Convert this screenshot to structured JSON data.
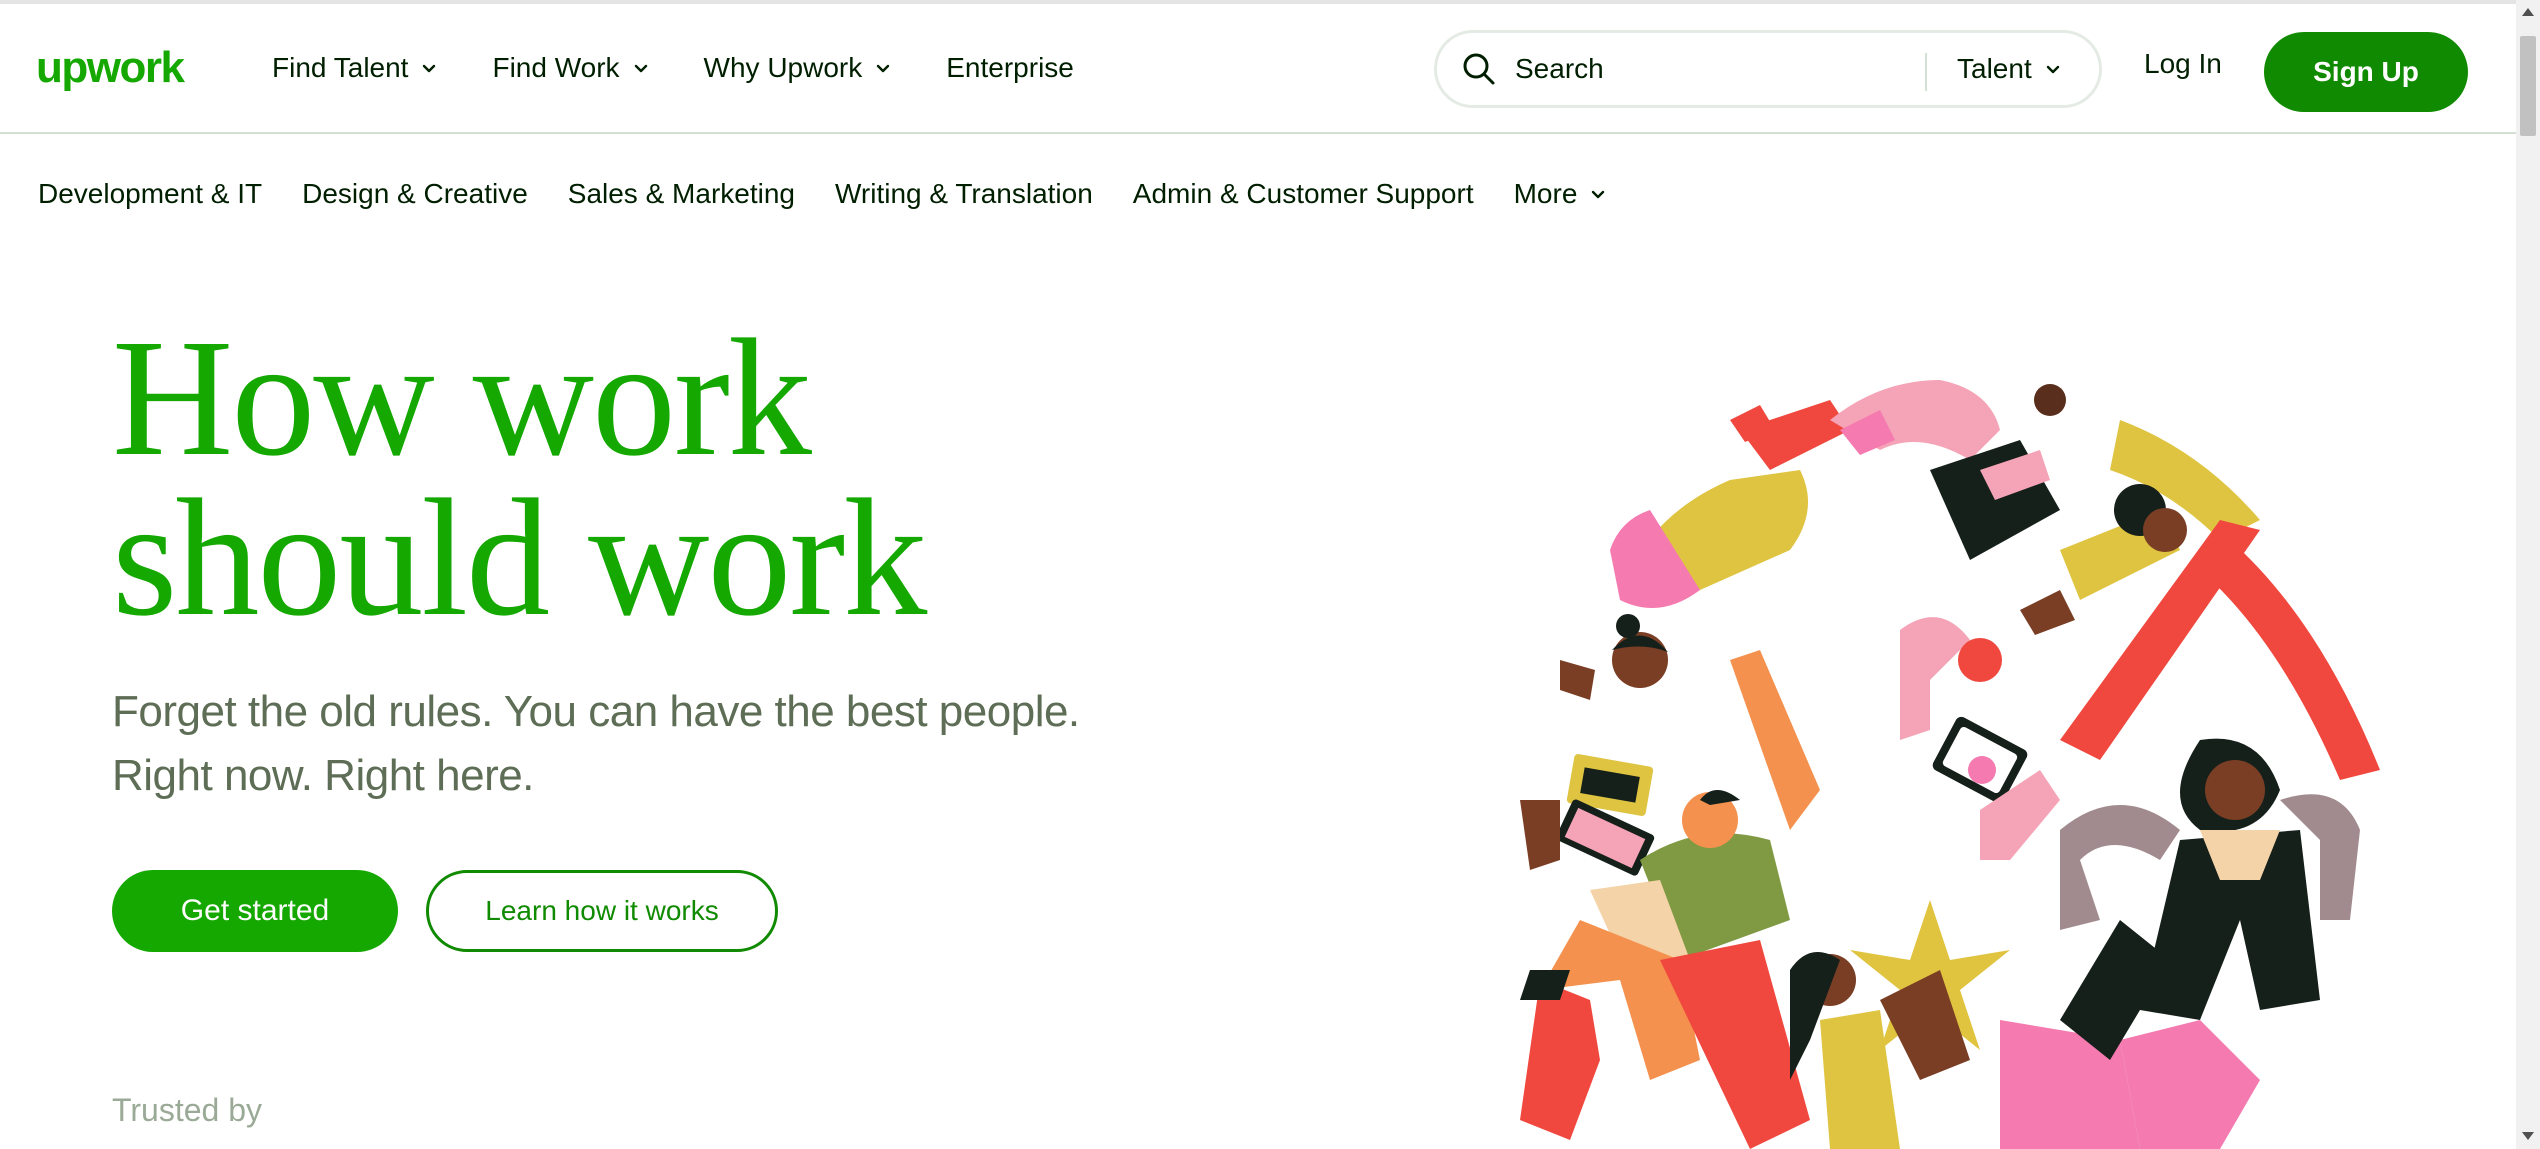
{
  "colors": {
    "brand_green": "#14a800",
    "dark_green": "#108a00",
    "text": "#001e00",
    "muted": "#5e6d55"
  },
  "header": {
    "logo_text": "upwork",
    "nav": [
      {
        "label": "Find Talent",
        "icon": "chevron-down-icon"
      },
      {
        "label": "Find Work",
        "icon": "chevron-down-icon"
      },
      {
        "label": "Why Upwork",
        "icon": "chevron-down-icon"
      },
      {
        "label": "Enterprise"
      }
    ],
    "search": {
      "placeholder": "Search",
      "scope": "Talent",
      "icon": "search-icon"
    },
    "login_label": "Log In",
    "signup_label": "Sign Up"
  },
  "categories": [
    {
      "label": "Development & IT"
    },
    {
      "label": "Design & Creative"
    },
    {
      "label": "Sales & Marketing"
    },
    {
      "label": "Writing & Translation"
    },
    {
      "label": "Admin & Customer Support"
    },
    {
      "label": "More",
      "icon": "chevron-down-icon"
    }
  ],
  "hero": {
    "headline_line1": "How work",
    "headline_line2": "should work",
    "sub_line1": "Forget the old rules. You can have the best people.",
    "sub_line2": "Right now. Right here.",
    "primary_cta": "Get started",
    "secondary_cta": "Learn how it works"
  },
  "trusted_by": "Trusted by"
}
